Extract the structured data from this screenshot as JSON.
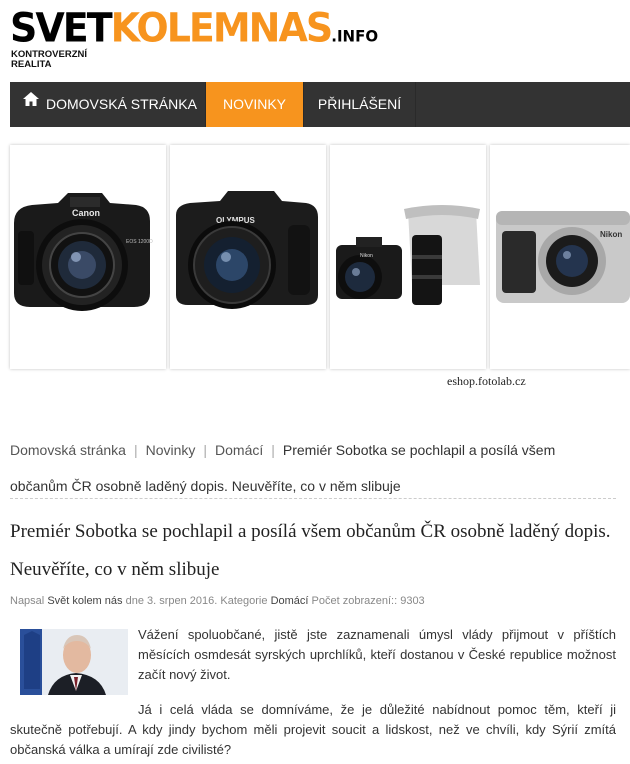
{
  "header": {
    "logo_svet": "SVET",
    "logo_kolem": "KOLEMNAS",
    "logo_info": ".INFO",
    "tagline_1": "KONTROVERZNÍ",
    "tagline_2": "REALITA"
  },
  "nav": {
    "items": [
      {
        "label": "DOMOVSKÁ STRÁNKA",
        "icon": "home-icon"
      },
      {
        "label": "NOVINKY",
        "active": true
      },
      {
        "label": "PŘIHLÁŠENÍ"
      }
    ],
    "bar_color": "#333333",
    "accent_color": "#f7941e"
  },
  "ad": {
    "source": "eshop.fotolab.cz",
    "cameras": [
      {
        "brand": "Canon",
        "model": "EOS 1200D"
      },
      {
        "brand": "OLYMPUS"
      },
      {
        "brand": "Nikon"
      },
      {
        "brand": "Nikon"
      }
    ]
  },
  "breadcrumb": {
    "items": [
      "Domovská stránka",
      "Novinky",
      "Domácí"
    ],
    "current": "Premiér Sobotka se pochlapil a posílá všem občanům ČR osobně laděný dopis. Neuvěříte, co v něm slibuje"
  },
  "article": {
    "title": "Premiér Sobotka se pochlapil a posílá všem občanům ČR osobně laděný dopis. Neuvěříte, co v něm slibuje",
    "meta": {
      "written_by_label": "Napsal",
      "author": "Svět kolem nás",
      "date_label": "dne",
      "date": "3. srpen 2016.",
      "category_label": "Kategorie",
      "category": "Domácí",
      "views_label": "Počet zobrazení::",
      "views": "9303"
    },
    "paragraphs": [
      "Vážení spoluobčané, jistě jste zaznamenali úmysl vlády přijmout v příštích měsících osmdesát syrských uprchlíků, kteří dostanou v České republice možnost začít nový život.",
      "Já i celá vláda se domníváme, že je důležité nabídnout pomoc těm, kteří ji skutečně potřebují. A kdy jindy bychom měli projevit soucit a lidskost, než ve chvíli, kdy Sýrií zmítá občanská válka a umírají zde civilisté?"
    ]
  }
}
